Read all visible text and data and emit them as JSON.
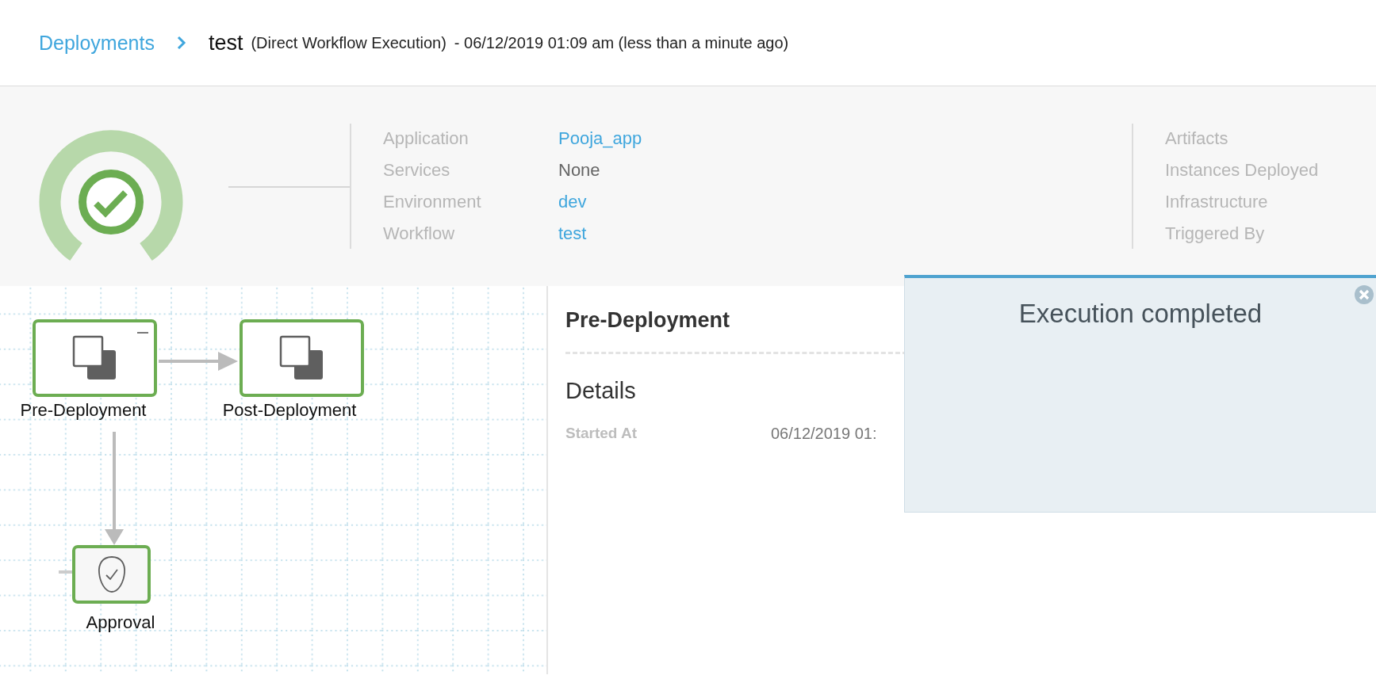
{
  "breadcrumb": {
    "parent": "Deployments",
    "title": "test",
    "subtitle": "(Direct Workflow Execution)",
    "timestamp": "- 06/12/2019 01:09 am (less than a minute ago)"
  },
  "summary": {
    "succeeded": true,
    "fields": [
      {
        "label": "Application",
        "value": "Pooja_app",
        "link": true
      },
      {
        "label": "Services",
        "value": "None",
        "link": false
      },
      {
        "label": "Environment",
        "value": "dev",
        "link": true
      },
      {
        "label": "Workflow",
        "value": "test",
        "link": true
      }
    ],
    "right_fields": [
      "Artifacts",
      "Instances Deployed",
      "Infrastructure",
      "Triggered By"
    ]
  },
  "workflow": {
    "nodes": [
      {
        "label": "Pre-Deployment",
        "kind": "phase",
        "succeeded": true,
        "collapsible": true
      },
      {
        "label": "Post-Deployment",
        "kind": "phase",
        "succeeded": true,
        "collapsible": false
      },
      {
        "label": "Approval",
        "kind": "approval",
        "succeeded": true,
        "collapsible": false
      }
    ]
  },
  "details": {
    "title": "Pre-Deployment",
    "section": "Details",
    "rows": [
      {
        "label": "Started At",
        "value": "06/12/2019 01:"
      }
    ]
  },
  "toast": {
    "message": "Execution completed"
  }
}
